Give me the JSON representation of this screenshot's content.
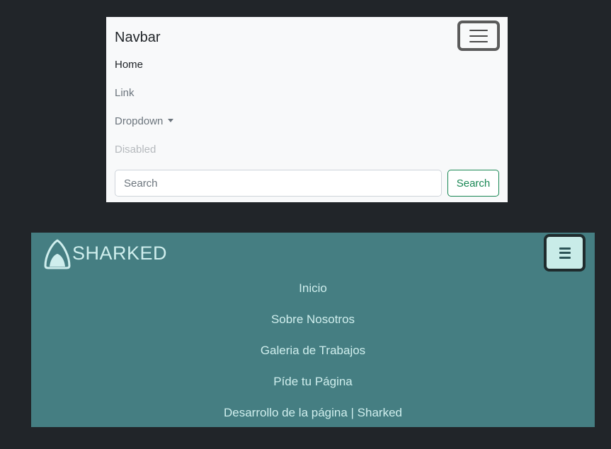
{
  "top_navbar": {
    "brand": "Navbar",
    "nav_items": [
      {
        "label": "Home",
        "state": "active"
      },
      {
        "label": "Link",
        "state": "normal"
      },
      {
        "label": "Dropdown",
        "state": "dropdown"
      },
      {
        "label": "Disabled",
        "state": "disabled"
      }
    ],
    "search": {
      "placeholder": "Search",
      "button_label": "Search"
    },
    "toggler_icon": "hamburger-icon",
    "colors": {
      "background": "#f8f9fa",
      "success": "#198754"
    }
  },
  "bottom_navbar": {
    "brand": "SHARKED",
    "logo_icon": "shark-fin-icon",
    "toggler_icon": "hamburger-icon",
    "nav_items": [
      {
        "label": "Inicio"
      },
      {
        "label": "Sobre Nosotros"
      },
      {
        "label": "Galeria de Trabajos"
      },
      {
        "label": "Píde tu Página"
      },
      {
        "label": "Desarrollo de la página | Sharked"
      }
    ],
    "colors": {
      "background": "#457e82",
      "text": "#cfeeed",
      "toggler_background": "#c9ece8"
    }
  },
  "page_background": "#212529"
}
